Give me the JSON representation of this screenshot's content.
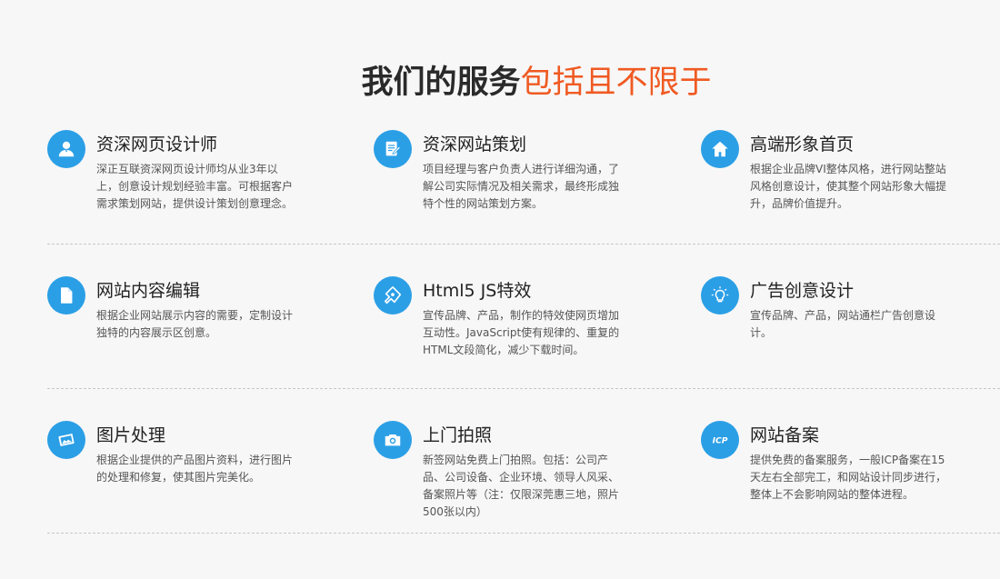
{
  "header": {
    "title_dark": "我们的服务",
    "title_accent": "包括且不限于"
  },
  "colors": {
    "accent": "#f05a22",
    "icon_bg": "#2b9fe6",
    "title_dark": "#2a2a2a"
  },
  "services": [
    {
      "icon": "user-icon",
      "title": "资深网页设计师",
      "desc": "深正互联资深网页设计师均从业3年以上，创意设计规划经验丰富。可根据客户需求策划网站，提供设计策划创意理念。"
    },
    {
      "icon": "document-edit-icon",
      "title": "资深网站策划",
      "desc": "项目经理与客户负责人进行详细沟通，了解公司实际情况及相关需求，最终形成独特个性的网站策划方案。"
    },
    {
      "icon": "home-icon",
      "title": "高端形象首页",
      "desc": "根据企业品牌VI整体风格，进行网站整站风格创意设计，使其整个网站形象大幅提升，品牌价值提升。"
    },
    {
      "icon": "file-icon",
      "title": "网站内容编辑",
      "desc": "根据企业网站展示内容的需要，定制设计独特的内容展示区创意。"
    },
    {
      "icon": "pen-tool-icon",
      "title": "Html5 JS特效",
      "desc": "宣传品牌、产品，制作的特效使网页增加互动性。JavaScript使有规律的、重复的HTML文段简化，减少下载时间。"
    },
    {
      "icon": "lightbulb-icon",
      "title": "广告创意设计",
      "desc": "宣传品牌、产品，网站通栏广告创意设计。"
    },
    {
      "icon": "image-icon",
      "title": "图片处理",
      "desc": "根据企业提供的产品图片资料，进行图片的处理和修复，使其图片完美化。"
    },
    {
      "icon": "camera-icon",
      "title": "上门拍照",
      "desc": "新签网站免费上门拍照。包括：公司产品、公司设备、企业环境、领导人风采、备案照片等（注：仅限深莞惠三地，照片500张以内）"
    },
    {
      "icon": "icp-icon",
      "title": "网站备案",
      "desc": "提供免费的备案服务，一般ICP备案在15天左右全部完工，和网站设计同步进行，整体上不会影响网站的整体进程。"
    }
  ]
}
